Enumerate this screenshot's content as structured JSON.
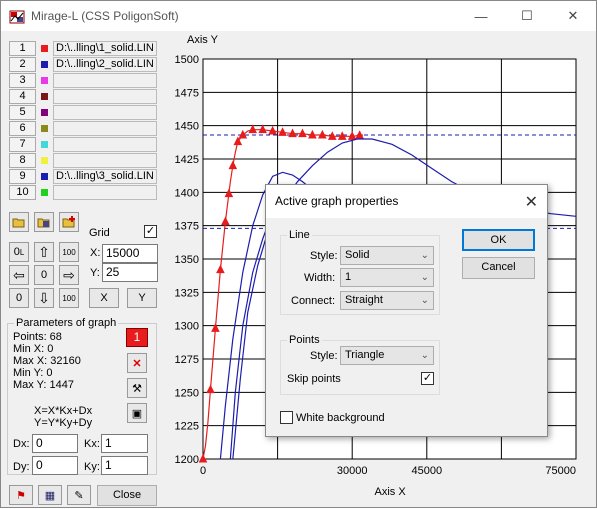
{
  "window": {
    "title": "Mirage-L (CSS PoligonSoft)",
    "icon": "app-icon",
    "controls": {
      "minimize": "—",
      "maximize": "☐",
      "close": "✕"
    }
  },
  "files": [
    {
      "num": "1",
      "color": "#e81c1c",
      "name": "D:\\..lling\\1_solid.LIN"
    },
    {
      "num": "2",
      "color": "#1c1cb0",
      "name": "D:\\..lling\\2_solid.LIN"
    },
    {
      "num": "3",
      "color": "#e838e8",
      "name": ""
    },
    {
      "num": "4",
      "color": "#7a1818",
      "name": ""
    },
    {
      "num": "5",
      "color": "#800080",
      "name": ""
    },
    {
      "num": "6",
      "color": "#8a8a1c",
      "name": ""
    },
    {
      "num": "7",
      "color": "#40d8d8",
      "name": ""
    },
    {
      "num": "8",
      "color": "#f0f040",
      "name": ""
    },
    {
      "num": "9",
      "color": "#1c1cb0",
      "name": "D:\\..lling\\3_solid.LIN"
    },
    {
      "num": "10",
      "color": "#20d020",
      "name": ""
    }
  ],
  "grid": {
    "label": "Grid",
    "checked": "✓",
    "x_label": "X:",
    "x_value": "15000",
    "y_label": "Y:",
    "y_value": "25"
  },
  "nav_buttons": {
    "zero": "0",
    "up": "⇧",
    "hundred_top": "100",
    "left": "⇦",
    "center": "0",
    "right": "⇨",
    "zero_bottom": "0",
    "down": "⇩",
    "hundred_bottom": "100",
    "x_fit": "X",
    "y_fit": "Y"
  },
  "params": {
    "title": "Parameters of graph",
    "points": "Points: 68",
    "min_x": "Min  X: 0",
    "max_x": "Max X: 32160",
    "min_y": "Min  Y: 0",
    "max_y": "Max Y: 1447",
    "graph_num": "1",
    "formula_x": "X=X*Kx+Dx",
    "formula_y": "Y=Y*Ky+Dy",
    "dx_label": "Dx:",
    "dx_value": "0",
    "kx_label": "Kx:",
    "kx_value": "1",
    "dy_label": "Dy:",
    "dy_value": "0",
    "ky_label": "Ky:",
    "ky_value": "1"
  },
  "bottom": {
    "close_label": "Close"
  },
  "chart_data": {
    "type": "line",
    "ylabel": "Axis Y",
    "xlabel": "Axis X",
    "xlim": [
      0,
      75000
    ],
    "ylim": [
      1200,
      1500
    ],
    "x_ticks": [
      0,
      30000,
      45000,
      75000
    ],
    "x_tick_labels": [
      "0",
      "30000",
      "45000",
      "75000"
    ],
    "y_ticks": [
      1200,
      1225,
      1250,
      1275,
      1300,
      1325,
      1350,
      1375,
      1400,
      1425,
      1450,
      1475,
      1500
    ],
    "y_tick_labels": [
      "1200",
      "1225",
      "1250",
      "1275",
      "1300",
      "1325",
      "1350",
      "1375",
      "1400",
      "1425",
      "1450",
      "1475",
      "1500"
    ],
    "grid": true,
    "series": [
      {
        "color": "#e81c1c",
        "marker": "triangle",
        "x": [
          0,
          500,
          1000,
          1500,
          2000,
          2500,
          3000,
          3500,
          4000,
          4500,
          5000,
          5500,
          6000,
          6500,
          7000,
          8000,
          9000,
          10000,
          12000,
          14000,
          16000,
          18000,
          20000,
          22000,
          24000,
          26000,
          28000,
          30000,
          32160
        ],
        "y": [
          1200,
          1210,
          1228,
          1252,
          1275,
          1298,
          1320,
          1342,
          1360,
          1378,
          1393,
          1408,
          1420,
          1430,
          1438,
          1443,
          1446,
          1447,
          1447,
          1446,
          1445,
          1444,
          1444,
          1443,
          1443,
          1442,
          1442,
          1442,
          1443
        ],
        "marker_x": [
          0,
          1500,
          2500,
          3500,
          4500,
          5200,
          6000,
          7000,
          8000,
          10000,
          12000,
          14000,
          16000,
          18000,
          20000,
          22000,
          24000,
          26000,
          28000,
          30000,
          31500
        ]
      },
      {
        "color": "#1c1cb0",
        "x": [
          3500,
          4500,
          6000,
          8000,
          10000,
          12000,
          14000,
          16000,
          18000,
          20000,
          22000,
          25000,
          28000,
          31000,
          34000,
          38000,
          42000,
          46000,
          50000,
          55000,
          60000
        ],
        "y": [
          1200,
          1240,
          1290,
          1340,
          1375,
          1398,
          1412,
          1415,
          1413,
          1408,
          1402,
          1395,
          1388,
          1382,
          1376,
          1371,
          1368,
          1365,
          1363,
          1361,
          1360
        ]
      },
      {
        "color": "#1c1cb0",
        "x": [
          6000,
          7500,
          9000,
          11000,
          13000,
          16000,
          19000,
          22000,
          25000,
          28000,
          31000,
          34000,
          38000,
          42000,
          46000,
          50000,
          55000,
          60000,
          65000,
          70000,
          75000
        ],
        "y": [
          1200,
          1260,
          1310,
          1345,
          1370,
          1392,
          1408,
          1420,
          1430,
          1437,
          1440,
          1440,
          1436,
          1428,
          1418,
          1408,
          1398,
          1392,
          1387,
          1384,
          1382
        ]
      },
      {
        "color": "#1c1cb0",
        "x": [
          5500,
          6500,
          8000,
          10000,
          12000,
          14000,
          16000,
          18000,
          20000,
          22000,
          25000
        ],
        "y": [
          1200,
          1250,
          1300,
          1340,
          1365,
          1385,
          1395,
          1400,
          1400,
          1398,
          1395
        ]
      }
    ],
    "hlines": [
      {
        "y": 1443,
        "color": "#1c1cb0",
        "style": "dashed"
      },
      {
        "y": 1373,
        "color": "#1c1cb0",
        "style": "dashed"
      }
    ]
  },
  "dialog": {
    "title": "Active graph properties",
    "close": "✕",
    "line_group": "Line",
    "style_label": "Style:",
    "style_value": "Solid",
    "width_label": "Width:",
    "width_value": "1",
    "connect_label": "Connect:",
    "connect_value": "Straight",
    "points_group": "Points",
    "pstyle_label": "Style:",
    "pstyle_value": "Triangle",
    "skip_label": "Skip points",
    "skip_checked": "✓",
    "white_bg_label": "White background",
    "ok_label": "OK",
    "cancel_label": "Cancel"
  }
}
